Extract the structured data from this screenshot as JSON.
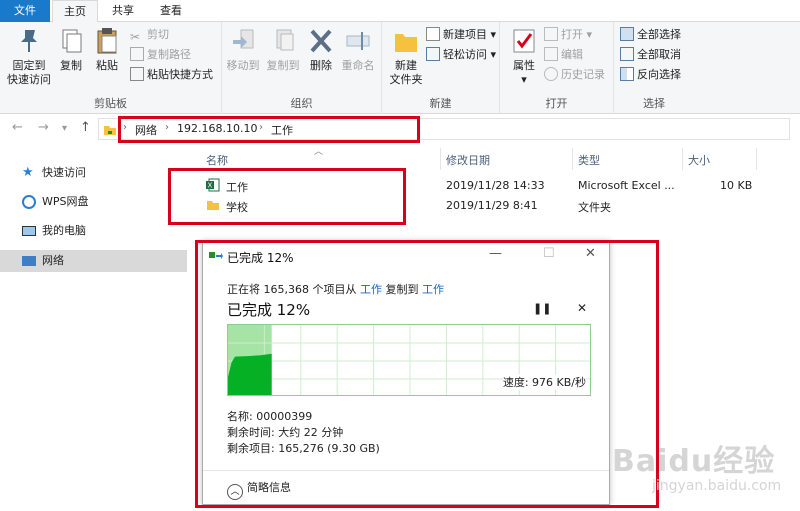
{
  "tabs": {
    "file": "文件",
    "home": "主页",
    "share": "共享",
    "view": "查看"
  },
  "ribbon": {
    "clipboard": {
      "label": "剪贴板",
      "pin": "固定到\n快速访问",
      "copy": "复制",
      "paste": "粘贴",
      "cut": "剪切",
      "copy_path": "复制路径",
      "paste_shortcut": "粘贴快捷方式"
    },
    "organize": {
      "label": "组织",
      "move_to": "移动到",
      "copy_to": "复制到",
      "delete": "删除",
      "rename": "重命名"
    },
    "new": {
      "label": "新建",
      "new_folder": "新建\n文件夹",
      "new_item": "新建项目",
      "easy_access": "轻松访问"
    },
    "open": {
      "label": "打开",
      "properties": "属性",
      "open": "打开",
      "edit": "编辑",
      "history": "历史记录"
    },
    "select": {
      "label": "选择",
      "select_all": "全部选择",
      "select_none": "全部取消",
      "invert": "反向选择"
    }
  },
  "address": {
    "crumbs": [
      "网络",
      "192.168.10.10",
      "工作"
    ]
  },
  "sidebar": {
    "items": [
      {
        "label": "快速访问"
      },
      {
        "label": "WPS网盘"
      },
      {
        "label": "我的电脑"
      },
      {
        "label": "网络"
      }
    ]
  },
  "list": {
    "columns": [
      "名称",
      "修改日期",
      "类型",
      "大小"
    ],
    "rows": [
      {
        "name": "工作",
        "date": "2019/11/28 14:33",
        "type": "Microsoft Excel ...",
        "size": "10 KB"
      },
      {
        "name": "学校",
        "date": "2019/11/29 8:41",
        "type": "文件夹",
        "size": ""
      }
    ]
  },
  "dialog": {
    "title": "已完成 12%",
    "line_prefix": "正在将 165,368 个项目从",
    "from": "工作",
    "mid": "复制到",
    "to": "工作",
    "percent_text": "已完成 12%",
    "progress": 12,
    "speed": "速度: 976 KB/秒",
    "name": "名称: 00000399",
    "time_left": "剩余时间: 大约 22 分钟",
    "items_left": "剩余项目: 165,276 (9.30 GB)",
    "less_details": "简略信息"
  },
  "colors": {
    "accent": "#1979ca",
    "highlight": "#d9001b",
    "graph_fill": "#06b025",
    "graph_done": "#a6e4a6"
  },
  "watermark": {
    "brand": "Baidu经验",
    "url": "jingyan.baidu.com"
  }
}
